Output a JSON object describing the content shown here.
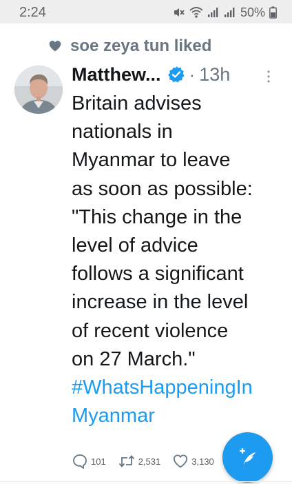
{
  "status_bar": {
    "time": "2:24",
    "battery": "50%",
    "icons": [
      "mute-icon",
      "wifi-icon",
      "signal-icon",
      "signal-icon",
      "battery-icon"
    ]
  },
  "social_context": {
    "icon": "heart-icon",
    "text": "soe zeya tun liked"
  },
  "tweet": {
    "author_name": "Matthew...",
    "verified": true,
    "separator": "·",
    "timestamp": "13h",
    "body_lines": [
      "Britain advises",
      "nationals in",
      "Myanmar to leave",
      "as soon as possible:",
      "\"This change in the",
      "level of advice",
      "follows a significant",
      "increase in the level",
      "of recent violence",
      "on 27 March.\""
    ],
    "hashtag_lines": [
      "#WhatsHappeningIn",
      "Myanmar"
    ],
    "actions": {
      "reply_count": "101",
      "retweet_count": "2,531",
      "like_count": "3,130"
    }
  },
  "fab": {
    "icon": "compose-tweet-icon"
  },
  "colors": {
    "accent": "#1d9bf0",
    "secondary_text": "#687684",
    "primary_text": "#14171a",
    "status_bar_bg": "#eeeeee"
  }
}
